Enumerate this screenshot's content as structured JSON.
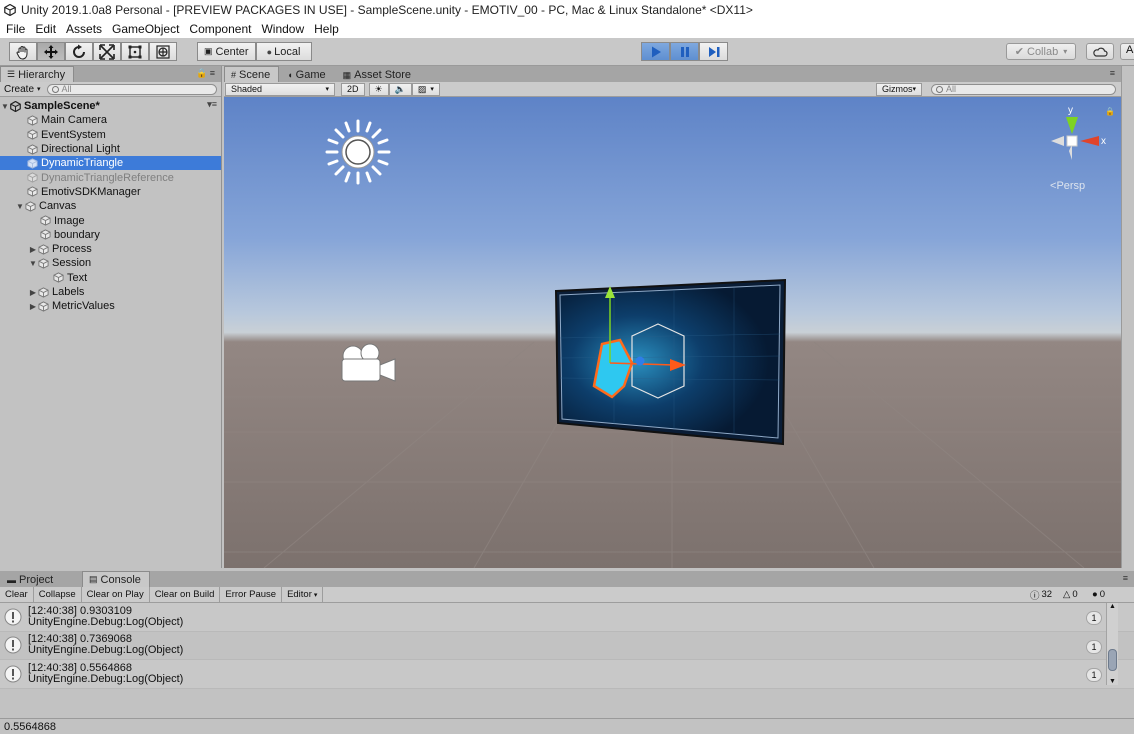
{
  "window": {
    "title": "Unity 2019.1.0a8 Personal - [PREVIEW PACKAGES IN USE] - SampleScene.unity - EMOTIV_00 - PC, Mac & Linux Standalone* <DX11>"
  },
  "menu": [
    "File",
    "Edit",
    "Assets",
    "GameObject",
    "Component",
    "Window",
    "Help"
  ],
  "toolbar": {
    "pivot_center": "Center",
    "pivot_local": "Local",
    "collab": "Collab",
    "account": "A"
  },
  "hierarchy": {
    "tab": "Hierarchy",
    "create": "Create",
    "search_placeholder": "All",
    "scene": "SampleScene*",
    "items": [
      {
        "label": "Main Camera"
      },
      {
        "label": "EventSystem"
      },
      {
        "label": "Directional Light"
      },
      {
        "label": "DynamicTriangle"
      },
      {
        "label": "DynamicTriangleReference"
      },
      {
        "label": "EmotivSDKManager"
      },
      {
        "label": "Canvas"
      },
      {
        "label": "Image"
      },
      {
        "label": "boundary"
      },
      {
        "label": "Process"
      },
      {
        "label": "Session"
      },
      {
        "label": "Text"
      },
      {
        "label": "Labels"
      },
      {
        "label": "MetricValues"
      }
    ]
  },
  "scene": {
    "tabs": [
      "Scene",
      "Game",
      "Asset Store"
    ],
    "shading": "Shaded",
    "mode_2d": "2D",
    "gizmos": "Gizmos",
    "search_placeholder": "All",
    "gizmo_y": "y",
    "gizmo_x": "x",
    "persp": "Persp"
  },
  "console": {
    "tabs": [
      "Project",
      "Console"
    ],
    "buttons": [
      "Clear",
      "Collapse",
      "Clear on Play",
      "Clear on Build",
      "Error Pause",
      "Editor"
    ],
    "counts": {
      "log": "32",
      "warn": "0",
      "error": "0"
    },
    "entries": [
      {
        "line1": "[12:40:38] 0.9303109",
        "line2": "UnityEngine.Debug:Log(Object)",
        "count": "1"
      },
      {
        "line1": "[12:40:38] 0.7369068",
        "line2": "UnityEngine.Debug:Log(Object)",
        "count": "1"
      },
      {
        "line1": "[12:40:38] 0.5564868",
        "line2": "UnityEngine.Debug:Log(Object)",
        "count": "1"
      }
    ]
  },
  "status": {
    "text": "0.5564868"
  },
  "colors": {
    "selection": "#3d7bd9",
    "play_active": "#6e9bd8",
    "panel_bg": "#c2c2c2"
  }
}
